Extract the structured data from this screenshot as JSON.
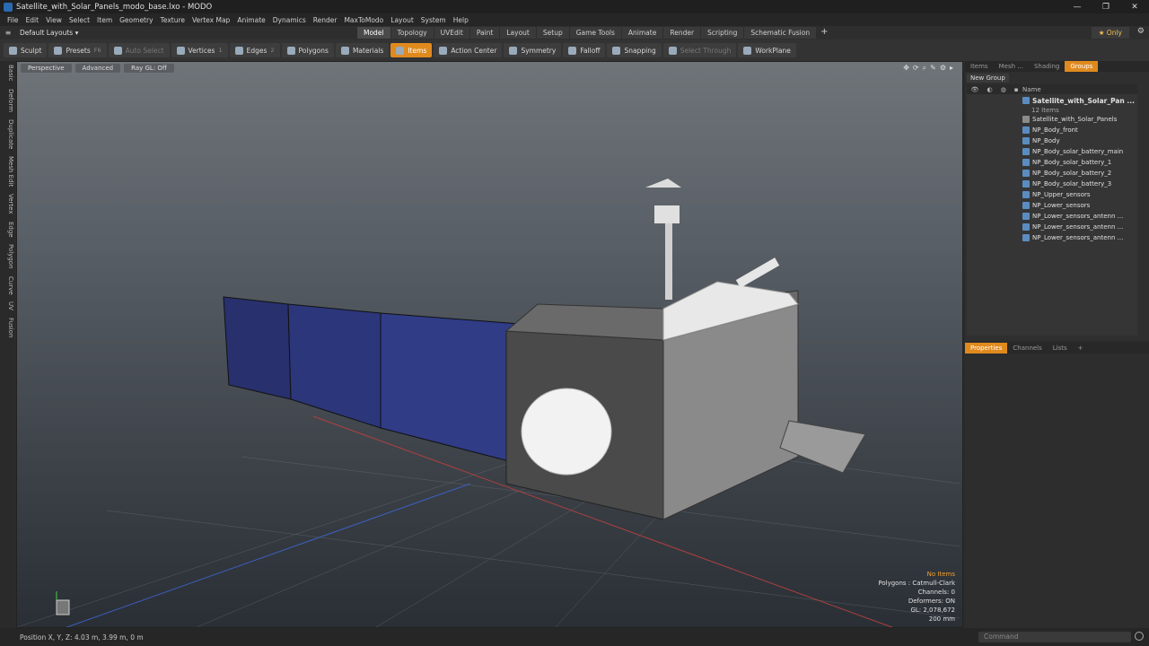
{
  "window": {
    "title": "Satellite_with_Solar_Panels_modo_base.lxo - MODO",
    "min": "—",
    "max": "❐",
    "close": "✕"
  },
  "menu": [
    "File",
    "Edit",
    "View",
    "Select",
    "Item",
    "Geometry",
    "Texture",
    "Vertex Map",
    "Animate",
    "Dynamics",
    "Render",
    "MaxToModo",
    "Layout",
    "System",
    "Help"
  ],
  "layouts": {
    "label": "Default Layouts ▾"
  },
  "tabs": [
    "Model",
    "Topology",
    "UVEdit",
    "Paint",
    "Layout",
    "Setup",
    "Game Tools",
    "Animate",
    "Render",
    "Scripting",
    "Schematic Fusion"
  ],
  "only_label": "★  Only",
  "toolbar": {
    "sculpt": "Sculpt",
    "presets": "Presets",
    "presets_key": "F6",
    "auto_select": "Auto Select",
    "vertices": "Vertices",
    "vertices_key": "1",
    "edges": "Edges",
    "edges_key": "2",
    "polygons": "Polygons",
    "materials": "Materials",
    "items": "Items",
    "action_center": "Action Center",
    "symmetry": "Symmetry",
    "falloff": "Falloff",
    "snapping": "Snapping",
    "select_through": "Select Through",
    "workplane": "WorkPlane"
  },
  "left_tabs": [
    "Basic",
    "Deform",
    "Duplicate",
    "Mesh Edit",
    "Vertex",
    "Edge",
    "Polygon",
    "Curve",
    "UV",
    "Fusion"
  ],
  "viewport": {
    "perspective": "Perspective",
    "advanced": "Advanced",
    "raygl": "Ray GL: Off"
  },
  "stats": {
    "no_items": "No Items",
    "polygons": "Polygons : Catmull-Clark",
    "channels": "Channels: 0",
    "deformers": "Deformers: ON",
    "gl": "GL: 2,078,672",
    "scale": "200 mm"
  },
  "status": {
    "position": "Position X, Y, Z:   4.03 m, 3.99 m, 0 m",
    "command_placeholder": "Command"
  },
  "right_panel": {
    "tabs": [
      "Items",
      "Mesh ...",
      "Shading",
      "Groups"
    ],
    "new_group": "New Group",
    "name_header": "Name",
    "root": "Satellite_with_Solar_Pan ...",
    "root_count": "12 Items",
    "items": [
      "Satellite_with_Solar_Panels",
      "NP_Body_front",
      "NP_Body",
      "NP_Body_solar_battery_main",
      "NP_Body_solar_battery_1",
      "NP_Body_solar_battery_2",
      "NP_Body_solar_battery_3",
      "NP_Upper_sensors",
      "NP_Lower_sensors",
      "NP_Lower_sensors_antenn ...",
      "NP_Lower_sensors_antenn ...",
      "NP_Lower_sensors_antenn ..."
    ],
    "bottom_tabs": [
      "Properties",
      "Channels",
      "Lists"
    ]
  }
}
